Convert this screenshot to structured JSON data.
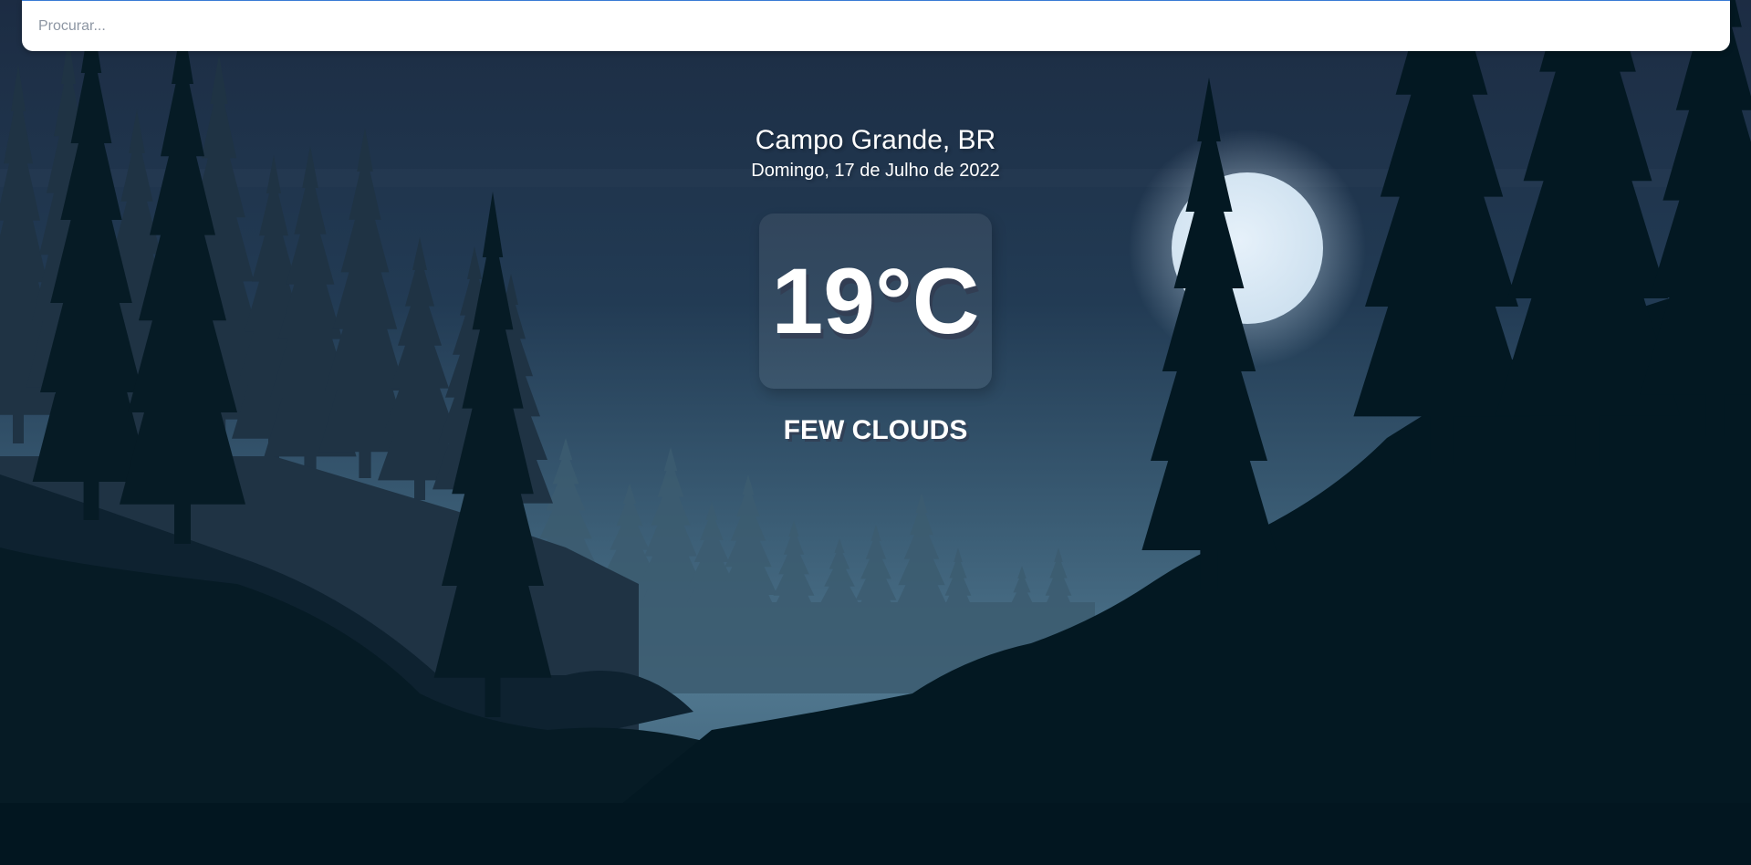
{
  "search": {
    "placeholder": "Procurar...",
    "value": ""
  },
  "location": {
    "city": "Campo Grande, BR",
    "date": "Domingo, 17 de Julho de 2022"
  },
  "weather": {
    "temperature": "19°C",
    "description": "FEW CLOUDS"
  },
  "colors": {
    "sky_top": "#1d2e45",
    "sky_bottom": "#4b7089",
    "moon": "#dbe9f5",
    "foreground": "#021820"
  }
}
